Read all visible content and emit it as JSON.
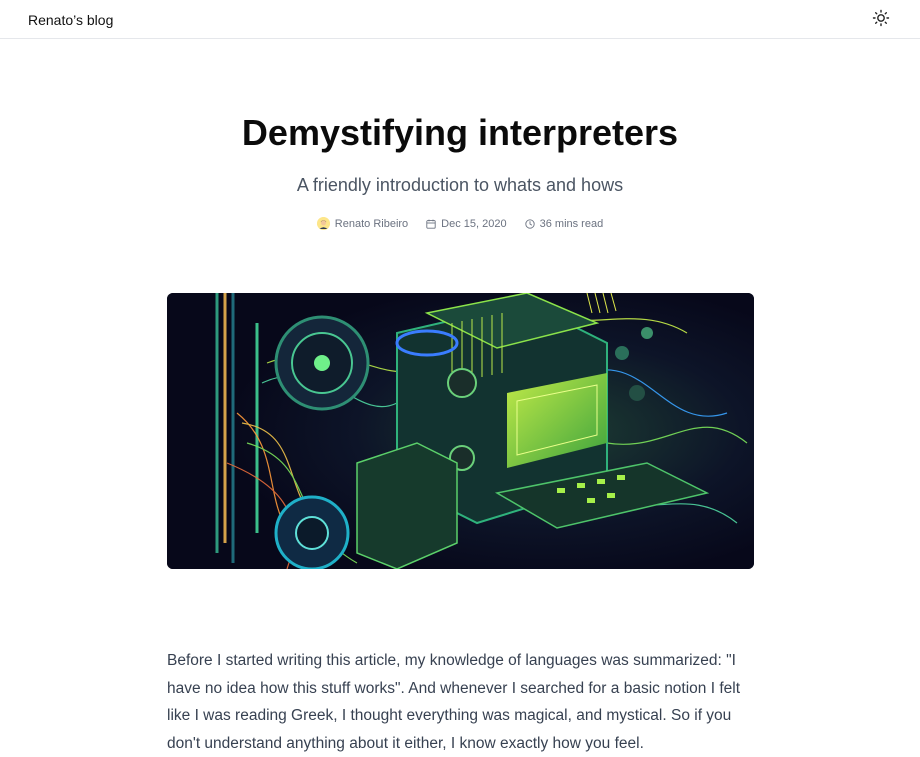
{
  "header": {
    "brand": "Renato’s blog",
    "theme_toggle_icon": "sun-icon"
  },
  "article": {
    "title": "Demystifying interpreters",
    "subtitle": "A friendly introduction to whats and hows",
    "author": "Renato Ribeiro",
    "date": "Dec 15, 2020",
    "read_time": "36 mins read",
    "hero_image": "circuit-machine-illustration",
    "intro": "Before I started writing this article, my knowledge of languages was summarized: \"I have no idea how this stuff works\". And whenever I searched for a basic notion I felt like I was reading Greek, I thought everything was magical, and mystical. So if you don't understand anything about it either, I know exactly how you feel."
  },
  "colors": {
    "border": "#e5e7eb",
    "subtitle": "#4b5563",
    "meta": "#6b7280",
    "body": "#374151",
    "hero_bg": "#0a0b18",
    "accent_green": "#7cff4f",
    "accent_teal": "#19c3b4"
  }
}
